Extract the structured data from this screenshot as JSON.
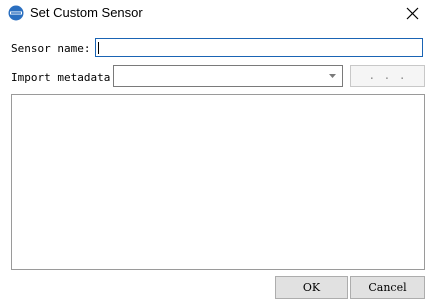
{
  "window": {
    "title": "Set Custom Sensor",
    "icon": "app-logo-icon",
    "close_icon": "close-icon"
  },
  "form": {
    "sensor_name_label": "Sensor name:",
    "sensor_name_value": "",
    "import_metadata_label": "Import metadata:",
    "import_metadata_value": "",
    "browse_label": ". . ."
  },
  "buttons": {
    "ok": "OK",
    "cancel": "Cancel"
  },
  "colors": {
    "focus_border": "#1a64b4",
    "button_bg": "#e1e1e1",
    "logo": "#2a6fc0"
  }
}
